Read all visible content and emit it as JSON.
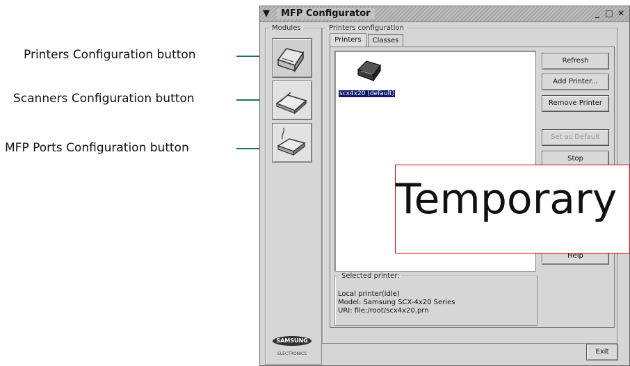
{
  "callouts": [
    "Printers Configuration button",
    "Scanners Configuration button",
    "MFP Ports Configuration button"
  ],
  "window": {
    "title": "MFP Configurator",
    "controls": {
      "minimize": "_",
      "maximize": "□",
      "close": "✕"
    }
  },
  "modules": {
    "legend": "Modules",
    "buttons": [
      "printer-icon",
      "scanner-icon",
      "port-icon"
    ]
  },
  "printers_config": {
    "legend": "Printers configuration",
    "tabs": [
      "Printers",
      "Classes"
    ],
    "active_tab": "Printers",
    "printer_item": {
      "label": "scx4x20 (default)",
      "selected": true
    },
    "buttons": [
      {
        "label": "Refresh",
        "enabled": true
      },
      {
        "label": "Add Printer...",
        "enabled": true
      },
      {
        "label": "Remove Printer",
        "enabled": true
      },
      {
        "label": "Set as Default",
        "enabled": false
      },
      {
        "label": "Stop",
        "enabled": true
      },
      {
        "label": "Help",
        "enabled": true
      }
    ],
    "selected_printer": {
      "legend": "Selected printer:",
      "lines": [
        "Local printer(idle)",
        "Model: Samsung SCX-4x20 Series",
        "URI: file:/root/scx4x20.prn"
      ]
    }
  },
  "logo": {
    "brand": "SAMSUNG",
    "sub": "ELECTRONICS"
  },
  "exit_label": "Exit",
  "overlay_text": "Temporary",
  "colors": {
    "leader": "#1f6f6a",
    "overlay_border": "#dd0000",
    "window_bg": "#d6d6d6"
  }
}
